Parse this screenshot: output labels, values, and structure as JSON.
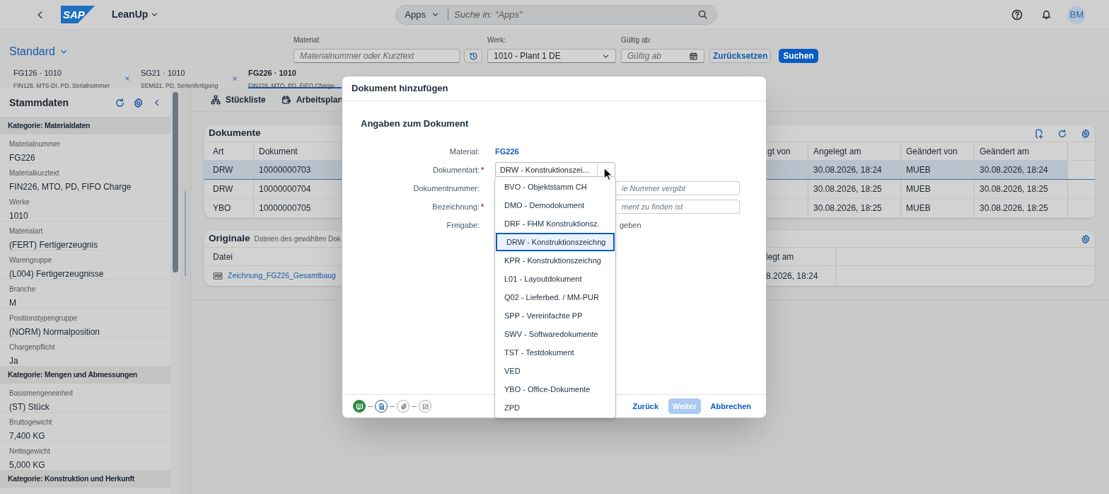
{
  "shell": {
    "title": "LeanUp",
    "logo": "SAP",
    "search": {
      "scope": "Apps",
      "placeholder": "Suche in: \"Apps\""
    },
    "avatar": "BM"
  },
  "variant": "Standard",
  "filters": [
    {
      "kind": "text",
      "label": "Material:",
      "placeholder": "Materialnummer oder Kurztext"
    },
    {
      "kind": "select",
      "label": "Werk:",
      "value": "1010 - Plant 1 DE"
    },
    {
      "kind": "date",
      "label": "Gültig ab:",
      "placeholder": "Gültig ab"
    }
  ],
  "filter_buttons": [
    {
      "label": "Zurücksetzen",
      "kind": "secondary"
    },
    {
      "label": "Suchen",
      "kind": "primary"
    }
  ],
  "tabs": [
    {
      "title": "FG126 · 1010",
      "subtitle": "FIN126, MTS-DI, PD, Serialnummer",
      "selected": false
    },
    {
      "title": "SG21 · 1010",
      "subtitle": "SEMI21, PD, Serienfertigung",
      "selected": false
    },
    {
      "title": "FG226 · 1010",
      "subtitle": "FIN226, MTO, PD, FIFO Charge",
      "selected": true
    }
  ],
  "sidebar": {
    "title": "Stammdaten",
    "groups": [
      {
        "category": "Kategorie: Materialdaten",
        "fields": [
          {
            "label": "Materialnummer",
            "value": "FG226"
          },
          {
            "label": "Materialkurztext",
            "value": "FIN226, MTO, PD, FIFO Charge"
          },
          {
            "label": "Werke",
            "value": "1010"
          },
          {
            "label": "Materialart",
            "value": "(FERT) Fertigerzeugnis"
          },
          {
            "label": "Warengruppe",
            "value": "(L004) Fertigerzeugnisse"
          },
          {
            "label": "Branche",
            "value": "M"
          },
          {
            "label": "Positionstypengruppe",
            "value": "(NORM) Normalposition"
          },
          {
            "label": "Chargenpflicht",
            "value": "Ja"
          }
        ]
      },
      {
        "category": "Kategorie: Mengen und Abmessungen",
        "fields": [
          {
            "label": "Basismengeneinheit",
            "value": "(ST) Stück"
          },
          {
            "label": "Bruttogewicht",
            "value": "7,400 KG"
          },
          {
            "label": "Nettogewicht",
            "value": "5,000 KG"
          }
        ]
      },
      {
        "category": "Kategorie: Konstruktion und Herkunft"
      }
    ]
  },
  "toolbar": [
    {
      "kind": "hierarchy",
      "label": "Stückliste"
    },
    {
      "kind": "calendar",
      "label": "Arbeitsplan"
    }
  ],
  "documents": {
    "title": "Dokumente",
    "columns": [
      "Art",
      "Dokument",
      "gt von",
      "Angelegt am",
      "Geändert von",
      "Geändert am"
    ],
    "rows": [
      {
        "art": "DRW",
        "dokument": "10000000703",
        "angelegt_am": "30.08.2026, 18:24",
        "geaendert_von": "MUEB",
        "geaendert_am": "30.08.2026, 18:24",
        "selected": true
      },
      {
        "art": "DRW",
        "dokument": "10000000704",
        "angelegt_am": "30.08.2026, 18:25",
        "geaendert_von": "MUEB",
        "geaendert_am": "30.08.2026, 18:25",
        "selected": false
      },
      {
        "art": "YBO",
        "dokument": "10000000705",
        "angelegt_am": "30.08.2026, 18:25",
        "geaendert_von": "MUEB",
        "geaendert_am": "30.08.2026, 18:25",
        "selected": false
      }
    ]
  },
  "originals": {
    "title": "Originale",
    "subtitle": "Dateien des gewählten Dok",
    "columns": [
      "Datei",
      "legt am"
    ],
    "rows": [
      {
        "file": "Zeichnung_FG226_Gesamtbaug",
        "date": "8.2026, 18:24"
      }
    ]
  },
  "dialog": {
    "title": "Dokument hinzufügen",
    "section": "Angaben zum Dokument",
    "fields": [
      {
        "kind": "link",
        "label": "Material:",
        "value": "FG226"
      },
      {
        "kind": "select",
        "label": "Dokumentart:",
        "required_mark": "*",
        "value": "DRW - Konstruktionszei..."
      },
      {
        "kind": "input",
        "label": "Dokumentnummer:",
        "placeholder": "ie Nummer vergibt"
      },
      {
        "kind": "input",
        "label": "Bezeichnung:",
        "required_mark": "*",
        "placeholder": "ment zu finden ist"
      },
      {
        "kind": "text",
        "label": "Freigabe:",
        "value": "geben"
      }
    ],
    "options": [
      {
        "label": "BVO - Objektstamm CH",
        "selected": false
      },
      {
        "label": "DMO - Demodokument",
        "selected": false
      },
      {
        "label": "DRF - FHM Konstruktionsz.",
        "selected": false
      },
      {
        "label": "DRW - Konstruktionszeichng",
        "selected": true
      },
      {
        "label": "KPR - Konstruktionszeichng",
        "selected": false
      },
      {
        "label": "L01 - Layoutdokument",
        "selected": false
      },
      {
        "label": "Q02 - Lieferbed. / MM-PUR",
        "selected": false
      },
      {
        "label": "SPP - Vereinfachte PP",
        "selected": false
      },
      {
        "label": "SWV - Softwaredokumente",
        "selected": false
      },
      {
        "label": "TST - Testdokument",
        "selected": false
      },
      {
        "label": "VED",
        "selected": false
      },
      {
        "label": "YBO - Office-Dokumente",
        "selected": false
      },
      {
        "label": "ZPD",
        "selected": false
      }
    ],
    "steps": [
      {
        "kind": "comment",
        "done": true,
        "current": false
      },
      {
        "kind": "document",
        "done": false,
        "current": true
      },
      {
        "kind": "attachment",
        "done": false,
        "current": false
      },
      {
        "kind": "check",
        "done": false,
        "current": false
      }
    ],
    "buttons": [
      {
        "label": "Zurück",
        "kind": "transparent",
        "disabled": false
      },
      {
        "label": "Weiter",
        "kind": "emphasized",
        "disabled": true
      },
      {
        "label": "Abbrechen",
        "kind": "transparent",
        "disabled": false
      }
    ]
  }
}
